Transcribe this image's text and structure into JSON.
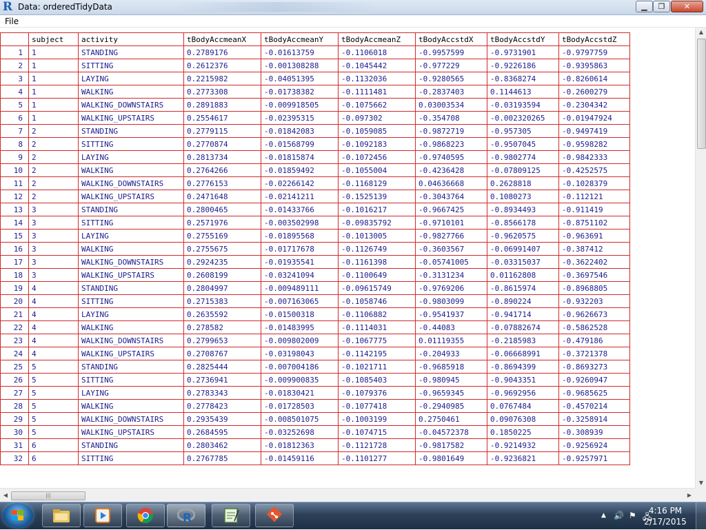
{
  "window": {
    "app_icon": "R",
    "title": "Data: orderedTidyData",
    "minimize_label": "▁",
    "maximize_label": "❐",
    "close_label": "✕"
  },
  "menu": {
    "file_label": "File"
  },
  "grid": {
    "columns": [
      "subject",
      "activity",
      "tBodyAccmeanX",
      "tBodyAccmeanY",
      "tBodyAccmeanZ",
      "tBodyAccstdX",
      "tBodyAccstdY",
      "tBodyAccstdZ"
    ],
    "rows": [
      [
        "1",
        "1",
        "STANDING",
        "0.2789176",
        "-0.01613759",
        "-0.1106018",
        "-0.9957599",
        "-0.9731901",
        "-0.9797759"
      ],
      [
        "2",
        "1",
        "SITTING",
        "0.2612376",
        "-0.001308288",
        "-0.1045442",
        "-0.977229",
        "-0.9226186",
        "-0.9395863"
      ],
      [
        "3",
        "1",
        "LAYING",
        "0.2215982",
        "-0.04051395",
        "-0.1132036",
        "-0.9280565",
        "-0.8368274",
        "-0.8260614"
      ],
      [
        "4",
        "1",
        "WALKING",
        "0.2773308",
        "-0.01738382",
        "-0.1111481",
        "-0.2837403",
        "0.1144613",
        "-0.2600279"
      ],
      [
        "5",
        "1",
        "WALKING_DOWNSTAIRS",
        "0.2891883",
        "-0.009918505",
        "-0.1075662",
        "0.03003534",
        "-0.03193594",
        "-0.2304342"
      ],
      [
        "6",
        "1",
        "WALKING_UPSTAIRS",
        "0.2554617",
        "-0.02395315",
        "-0.097302",
        "-0.354708",
        "-0.002320265",
        "-0.01947924"
      ],
      [
        "7",
        "2",
        "STANDING",
        "0.2779115",
        "-0.01842083",
        "-0.1059085",
        "-0.9872719",
        "-0.957305",
        "-0.9497419"
      ],
      [
        "8",
        "2",
        "SITTING",
        "0.2770874",
        "-0.01568799",
        "-0.1092183",
        "-0.9868223",
        "-0.9507045",
        "-0.9598282"
      ],
      [
        "9",
        "2",
        "LAYING",
        "0.2813734",
        "-0.01815874",
        "-0.1072456",
        "-0.9740595",
        "-0.9802774",
        "-0.9842333"
      ],
      [
        "10",
        "2",
        "WALKING",
        "0.2764266",
        "-0.01859492",
        "-0.1055004",
        "-0.4236428",
        "-0.07809125",
        "-0.4252575"
      ],
      [
        "11",
        "2",
        "WALKING_DOWNSTAIRS",
        "0.2776153",
        "-0.02266142",
        "-0.1168129",
        "0.04636668",
        "0.2628818",
        "-0.1028379"
      ],
      [
        "12",
        "2",
        "WALKING_UPSTAIRS",
        "0.2471648",
        "-0.02141211",
        "-0.1525139",
        "-0.3043764",
        "0.1080273",
        "-0.112121"
      ],
      [
        "13",
        "3",
        "STANDING",
        "0.2800465",
        "-0.01433766",
        "-0.1016217",
        "-0.9667425",
        "-0.8934493",
        "-0.911419"
      ],
      [
        "14",
        "3",
        "SITTING",
        "0.2571976",
        "-0.003502998",
        "-0.09835792",
        "-0.9710101",
        "-0.8566178",
        "-0.8751102"
      ],
      [
        "15",
        "3",
        "LAYING",
        "0.2755169",
        "-0.01895568",
        "-0.1013005",
        "-0.9827766",
        "-0.9620575",
        "-0.963691"
      ],
      [
        "16",
        "3",
        "WALKING",
        "0.2755675",
        "-0.01717678",
        "-0.1126749",
        "-0.3603567",
        "-0.06991407",
        "-0.387412"
      ],
      [
        "17",
        "3",
        "WALKING_DOWNSTAIRS",
        "0.2924235",
        "-0.01935541",
        "-0.1161398",
        "-0.05741005",
        "-0.03315037",
        "-0.3622402"
      ],
      [
        "18",
        "3",
        "WALKING_UPSTAIRS",
        "0.2608199",
        "-0.03241094",
        "-0.1100649",
        "-0.3131234",
        "0.01162808",
        "-0.3697546"
      ],
      [
        "19",
        "4",
        "STANDING",
        "0.2804997",
        "-0.009489111",
        "-0.09615749",
        "-0.9769206",
        "-0.8615974",
        "-0.8968805"
      ],
      [
        "20",
        "4",
        "SITTING",
        "0.2715383",
        "-0.007163065",
        "-0.1058746",
        "-0.9803099",
        "-0.890224",
        "-0.932203"
      ],
      [
        "21",
        "4",
        "LAYING",
        "0.2635592",
        "-0.01500318",
        "-0.1106882",
        "-0.9541937",
        "-0.941714",
        "-0.9626673"
      ],
      [
        "22",
        "4",
        "WALKING",
        "0.278582",
        "-0.01483995",
        "-0.1114031",
        "-0.44083",
        "-0.07882674",
        "-0.5862528"
      ],
      [
        "23",
        "4",
        "WALKING_DOWNSTAIRS",
        "0.2799653",
        "-0.009802009",
        "-0.1067775",
        "0.01119355",
        "-0.2185983",
        "-0.479186"
      ],
      [
        "24",
        "4",
        "WALKING_UPSTAIRS",
        "0.2708767",
        "-0.03198043",
        "-0.1142195",
        "-0.204933",
        "-0.06668991",
        "-0.3721378"
      ],
      [
        "25",
        "5",
        "STANDING",
        "0.2825444",
        "-0.007004186",
        "-0.1021711",
        "-0.9685918",
        "-0.8694399",
        "-0.8693273"
      ],
      [
        "26",
        "5",
        "SITTING",
        "0.2736941",
        "-0.009900835",
        "-0.1085403",
        "-0.980945",
        "-0.9043351",
        "-0.9260947"
      ],
      [
        "27",
        "5",
        "LAYING",
        "0.2783343",
        "-0.01830421",
        "-0.1079376",
        "-0.9659345",
        "-0.9692956",
        "-0.9685625"
      ],
      [
        "28",
        "5",
        "WALKING",
        "0.2778423",
        "-0.01728503",
        "-0.1077418",
        "-0.2940985",
        "0.0767484",
        "-0.4570214"
      ],
      [
        "29",
        "5",
        "WALKING_DOWNSTAIRS",
        "0.2935439",
        "-0.008501075",
        "-0.1003199",
        "0.2750461",
        "0.09076308",
        "-0.3258914"
      ],
      [
        "30",
        "5",
        "WALKING_UPSTAIRS",
        "0.2684595",
        "-0.03252698",
        "-0.1074715",
        "-0.04572378",
        "0.1850225",
        "-0.308939"
      ],
      [
        "31",
        "6",
        "STANDING",
        "0.2803462",
        "-0.01812363",
        "-0.1121728",
        "-0.9817582",
        "-0.9214932",
        "-0.9256924"
      ],
      [
        "32",
        "6",
        "SITTING",
        "0.2767785",
        "-0.01459116",
        "-0.1101277",
        "-0.9801649",
        "-0.9236821",
        "-0.9257971"
      ]
    ]
  },
  "colors": {
    "grid_line": "#cf2a2a",
    "cell_text": "#1c1c8c"
  },
  "taskbar": {
    "apps": [
      "file-explorer-icon",
      "media-player-icon",
      "chrome-icon",
      "r-console-icon",
      "notepad-icon",
      "git-icon"
    ]
  },
  "tray": {
    "time": "4:16 PM",
    "date": "2/17/2015"
  }
}
